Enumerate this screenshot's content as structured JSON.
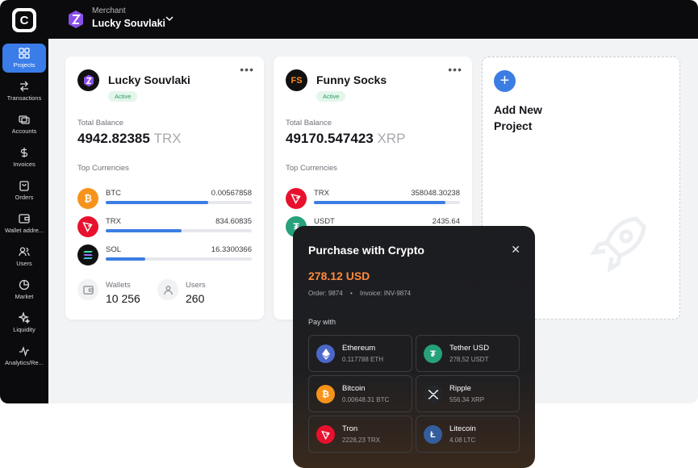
{
  "sidebar": {
    "items": [
      {
        "label": "Projects",
        "icon": "grid-icon",
        "active": true
      },
      {
        "label": "Transactions",
        "icon": "arrows-icon"
      },
      {
        "label": "Accounts",
        "icon": "accounts-icon"
      },
      {
        "label": "Invoices",
        "icon": "dollar-icon"
      },
      {
        "label": "Orders",
        "icon": "bag-icon"
      },
      {
        "label": "Wallet addre...",
        "icon": "wallet-icon"
      },
      {
        "label": "Users",
        "icon": "users-icon"
      },
      {
        "label": "Market",
        "icon": "pie-icon"
      },
      {
        "label": "Liquidity",
        "icon": "sparkle-icon"
      },
      {
        "label": "Analytics/Re...",
        "icon": "pulse-icon"
      }
    ]
  },
  "header": {
    "merchant_label": "Merchant",
    "merchant_name": "Lucky Souvlaki"
  },
  "projects": [
    {
      "name": "Lucky Souvlaki",
      "status": "Active",
      "total_balance_label": "Total Balance",
      "balance": "4942.82385",
      "currency": "TRX",
      "top_currencies_label": "Top Currencies",
      "currencies": [
        {
          "code": "BTC",
          "value": "0.00567858",
          "fill": 0.7,
          "color": "#f7931a"
        },
        {
          "code": "TRX",
          "value": "834.60835",
          "fill": 0.52,
          "color": "#e8112d"
        },
        {
          "code": "SOL",
          "value": "16.3300366",
          "fill": 0.27,
          "color": "#111111"
        }
      ],
      "wallets_label": "Wallets",
      "wallets": "10 256",
      "users_label": "Users",
      "users": "260"
    },
    {
      "name": "Funny Socks",
      "status": "Active",
      "total_balance_label": "Total Balance",
      "balance": "49170.547423",
      "currency": "XRP",
      "top_currencies_label": "Top Currencies",
      "currencies": [
        {
          "code": "TRX",
          "value": "358048.30238",
          "fill": 0.9,
          "color": "#e8112d"
        },
        {
          "code": "USDT",
          "value": "2435.64",
          "fill": 0.1,
          "color": "#26a17b"
        }
      ]
    }
  ],
  "add_project": {
    "label": "Add New Project"
  },
  "modal": {
    "title": "Purchase with Crypto",
    "amount": "278.12 USD",
    "order": "Order: 9874",
    "invoice": "Invoice: INV-9874",
    "pay_with": "Pay with",
    "options": [
      {
        "name": "Ethereum",
        "amount": "0.117788 ETH",
        "color": "#4b67c9"
      },
      {
        "name": "Tether USD",
        "amount": "278,52 USDT",
        "color": "#26a17b"
      },
      {
        "name": "Bitcoin",
        "amount": "0.00648.31 BTC",
        "color": "#f7931a"
      },
      {
        "name": "Ripple",
        "amount": "556.34 XRP",
        "color": "#25262a"
      },
      {
        "name": "Tron",
        "amount": "2228,23 TRX",
        "color": "#e8112d"
      },
      {
        "name": "Litecoin",
        "amount": "4.08 LTC",
        "color": "#345d9d"
      }
    ]
  }
}
